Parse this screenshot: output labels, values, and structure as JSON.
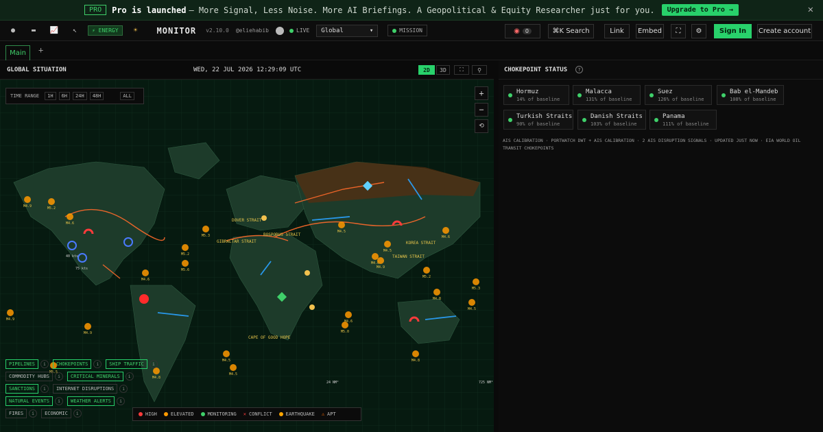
{
  "banner": {
    "badge": "PRO",
    "headline": "Pro is launched",
    "text": "– More Signal, Less Noise. More AI Briefings. A Geopolitical & Equity Researcher just for you.",
    "cta": "Upgrade to Pro →",
    "close": "✕"
  },
  "topbar": {
    "modes": [
      {
        "icon": "globe-icon",
        "glyph": "●"
      },
      {
        "icon": "monitor-icon",
        "glyph": "▬"
      },
      {
        "icon": "chart-icon",
        "glyph": "📈"
      },
      {
        "icon": "cursor-icon",
        "glyph": "↖"
      }
    ],
    "energy_label": "⚡ ENERGY",
    "sun_glyph": "☀",
    "app_title": "MONITOR",
    "version": "v2.10.0",
    "user": "@eliehabib",
    "live": "LIVE",
    "region": "Global",
    "mission": "MISSION",
    "counter": "0",
    "search": "⌘K  Search",
    "link": "Link",
    "embed": "Embed",
    "signin": "Sign In",
    "create": "Create account"
  },
  "tabs": {
    "main": "Main",
    "add": "+"
  },
  "left": {
    "title": "GLOBAL SITUATION",
    "datetime": "WED, 22 JUL 2026 12:29:09 UTC",
    "view_2d": "2D",
    "view_3d": "3D",
    "time_range": {
      "label": "TIME RANGE",
      "options": [
        "1H",
        "6H",
        "24H",
        "48H"
      ],
      "all": "ALL"
    },
    "zoom_in": "+",
    "zoom_out": "−",
    "reset": "⟲",
    "layers": [
      [
        {
          "label": "PIPELINES",
          "on": true
        },
        {
          "label": "CHOKEPOINTS",
          "on": true
        },
        {
          "label": "SHIP TRAFFIC",
          "on": true
        }
      ],
      [
        {
          "label": "COMMODITY HUBS",
          "on": false
        },
        {
          "label": "CRITICAL MINERALS",
          "on": true
        }
      ],
      [
        {
          "label": "SANCTIONS",
          "on": true
        },
        {
          "label": "INTERNET DISRUPTIONS",
          "on": false
        }
      ],
      [
        {
          "label": "NATURAL EVENTS",
          "on": true
        },
        {
          "label": "WEATHER ALERTS",
          "on": true
        }
      ],
      [
        {
          "label": "FIRES",
          "on": false
        },
        {
          "label": "ECONOMIC",
          "on": false
        }
      ]
    ],
    "legend": [
      {
        "label": "HIGH",
        "color": "#ff3b3b"
      },
      {
        "label": "ELEVATED",
        "color": "#ff9900"
      },
      {
        "label": "MONITORING",
        "color": "#3fd06a"
      },
      {
        "label": "CONFLICT",
        "color": "#ff3b3b",
        "glyph": "✕"
      },
      {
        "label": "EARTHQUAKE",
        "color": "#ffa500"
      },
      {
        "label": "APT",
        "color": "#ff6a00",
        "glyph": "⚠"
      }
    ],
    "map_labels": [
      "DOVER STRAIT",
      "GIBRALTAR STRAIT",
      "BOSPORUS STRAIT",
      "KOREA STRAIT",
      "TAIWAN STRAIT",
      "CAPE OF GOOD HOPE"
    ],
    "quakes": [
      "M4.9",
      "M5.2",
      "M4.6",
      "M5.3",
      "M5.2",
      "M5.6",
      "M4.6",
      "M4.9",
      "M5.5",
      "M4.8",
      "M4.5",
      "M4.6",
      "M4.5",
      "M4.5",
      "M4.6",
      "M4.8",
      "M5.0",
      "M4.5",
      "M4.8",
      "M4.9",
      "M4.5",
      "M4.6",
      "M5.2",
      "M5.3",
      "M4.9"
    ],
    "storm_labels": [
      "40 kts",
      "75 kts"
    ],
    "misc_labels": [
      "24 NM²",
      "725 NM²"
    ]
  },
  "right": {
    "title": "CHOKEPOINT STATUS",
    "help": "?",
    "chokepoints": [
      {
        "name": "Hormuz",
        "baseline": "14% of baseline"
      },
      {
        "name": "Malacca",
        "baseline": "131% of baseline"
      },
      {
        "name": "Suez",
        "baseline": "126% of baseline"
      },
      {
        "name": "Bab el-Mandeb",
        "baseline": "108% of baseline"
      },
      {
        "name": "Turkish Straits",
        "baseline": "90% of baseline"
      },
      {
        "name": "Danish Straits",
        "baseline": "103% of baseline"
      },
      {
        "name": "Panama",
        "baseline": "111% of baseline"
      }
    ],
    "source": "AIS CALIBRATION · PORTWATCH DWT + AIS CALIBRATION · 2 AIS DISRUPTION SIGNALS · UPDATED JUST NOW · EIA WORLD OIL TRANSIT CHOKEPOINTS"
  },
  "colors": {
    "accent": "#28d16b",
    "quake": "#ff9900",
    "pipeline": "#ff6a2a",
    "shipping": "#2aa3ff"
  }
}
